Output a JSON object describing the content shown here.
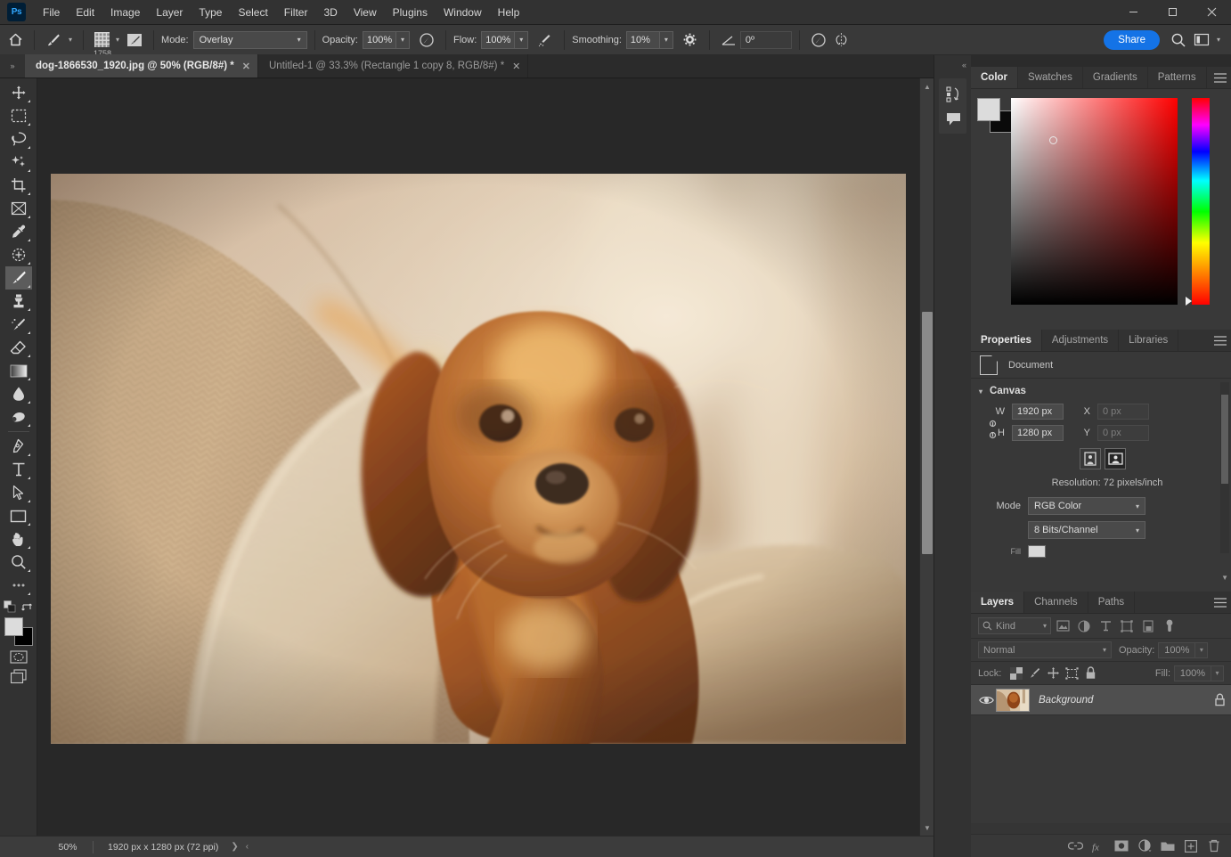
{
  "app": {
    "name": "Ps",
    "logo_color": "#31a8ff"
  },
  "menubar": {
    "items": [
      "File",
      "Edit",
      "Image",
      "Layer",
      "Type",
      "Select",
      "Filter",
      "3D",
      "View",
      "Plugins",
      "Window",
      "Help"
    ],
    "window_controls": {
      "minimize": "—",
      "maximize": "❐",
      "close": "✕"
    }
  },
  "options_bar": {
    "home_icon": "home-icon",
    "tool_icon": "brush-tool-icon",
    "brush_size": "1758",
    "brush_settings_icon": "brush-settings-icon",
    "mode_label": "Mode:",
    "mode_value": "Overlay",
    "opacity_label": "Opacity:",
    "opacity_value": "100%",
    "airbrush_icon": "airbrush-icon",
    "flow_label": "Flow:",
    "flow_value": "100%",
    "smoothing_toggle_icon": "smoothing-toggle-icon",
    "smoothing_label": "Smoothing:",
    "smoothing_value": "10%",
    "gear_icon": "gear-icon",
    "angle_icon": "angle-icon",
    "angle_value": "0º",
    "pressure_size_icon": "pressure-size-icon",
    "symmetry_icon": "symmetry-icon",
    "share_label": "Share",
    "search_icon": "search-icon",
    "workspace_icon": "workspace-icon",
    "workspace_chevron": "chevron-down-icon"
  },
  "tabbar": {
    "collapse_icon": "»",
    "tabs": [
      {
        "title": "dog-1866530_1920.jpg @ 50% (RGB/8#) *",
        "active": true,
        "close": "✕"
      },
      {
        "title": "Untitled-1 @ 33.3% (Rectangle 1 copy 8, RGB/8#) *",
        "active": false,
        "close": "✕"
      }
    ]
  },
  "toolbar": {
    "tools": [
      {
        "name": "move-tool",
        "active": false
      },
      {
        "name": "rectangular-marquee-tool",
        "active": false
      },
      {
        "name": "lasso-tool",
        "active": false
      },
      {
        "name": "object-selection-tool",
        "active": false
      },
      {
        "name": "crop-tool",
        "active": false
      },
      {
        "name": "frame-tool",
        "active": false
      },
      {
        "name": "eyedropper-tool",
        "active": false
      },
      {
        "name": "spot-healing-brush-tool",
        "active": false
      },
      {
        "name": "brush-tool",
        "active": true
      },
      {
        "name": "clone-stamp-tool",
        "active": false
      },
      {
        "name": "history-brush-tool",
        "active": false
      },
      {
        "name": "eraser-tool",
        "active": false
      },
      {
        "name": "gradient-tool",
        "active": false
      },
      {
        "name": "blur-tool",
        "active": false
      },
      {
        "name": "dodge-tool",
        "active": false
      },
      {
        "name": "pen-tool",
        "active": false
      },
      {
        "name": "horizontal-type-tool",
        "active": false
      },
      {
        "name": "path-selection-tool",
        "active": false
      },
      {
        "name": "rectangle-tool",
        "active": false
      },
      {
        "name": "hand-tool",
        "active": false
      },
      {
        "name": "zoom-tool",
        "active": false
      },
      {
        "name": "edit-toolbar-tool",
        "active": false
      }
    ],
    "foreground_color": "#dcdcdc",
    "background_color": "#000000",
    "swap_colors_icon": "swap-colors-icon",
    "default_colors_icon": "default-colors-icon",
    "quick_mask_icon": "quick-mask-icon",
    "screen_mode_icon": "screen-mode-icon"
  },
  "canvas": {
    "document_title": "dog-1866530_1920.jpg",
    "subject": "Cavalier King Charles Spaniel puppy on a beige herringbone armchair",
    "zoom_percent": "50%",
    "background_color": "#282828"
  },
  "statusbar": {
    "zoom": "50%",
    "doc_info": "1920 px x 1280 px (72 ppi)",
    "expand_icon": "❯",
    "collapse_icon": "‹"
  },
  "mini_dock": {
    "collapse_icon": "«",
    "buttons": [
      {
        "name": "history-panel-icon"
      },
      {
        "name": "comments-panel-icon"
      }
    ]
  },
  "color_panel": {
    "tabs": [
      "Color",
      "Swatches",
      "Gradients",
      "Patterns"
    ],
    "active_tab": "Color",
    "menu_icon": "panel-menu-icon",
    "foreground_color": "#dcdcdc",
    "background_color": "#0a0a0a",
    "field_type": "hue-saturation-brightness-square",
    "hue_value": "0"
  },
  "properties_panel": {
    "tabs": [
      "Properties",
      "Adjustments",
      "Libraries"
    ],
    "active_tab": "Properties",
    "menu_icon": "panel-menu-icon",
    "header_icon": "document-icon",
    "header_label": "Document",
    "section_title": "Canvas",
    "width_label": "W",
    "width_value": "1920 px",
    "height_label": "H",
    "height_value": "1280 px",
    "x_label": "X",
    "x_value": "0 px",
    "y_label": "Y",
    "y_value": "0 px",
    "link_icon": "link-dimensions-icon",
    "orientation_portrait_icon": "portrait-orientation-icon",
    "orientation_landscape_icon": "landscape-orientation-icon",
    "orientation_selected": "landscape",
    "resolution_text": "Resolution: 72 pixels/inch",
    "mode_label": "Mode",
    "color_mode_value": "RGB Color",
    "bit_depth_value": "8 Bits/Channel",
    "fill_label": "Fill"
  },
  "layers_panel": {
    "tabs": [
      "Layers",
      "Channels",
      "Paths"
    ],
    "active_tab": "Layers",
    "menu_icon": "panel-menu-icon",
    "filter_label": "Kind",
    "filter_search_icon": "search-icon",
    "filter_icons": [
      "pixel-layer-filter-icon",
      "adjustment-layer-filter-icon",
      "type-layer-filter-icon",
      "shape-layer-filter-icon",
      "smart-object-filter-icon",
      "filter-toggle-icon"
    ],
    "blend_mode": "Normal",
    "opacity_label": "Opacity:",
    "opacity_value": "100%",
    "lock_label": "Lock:",
    "lock_icons": [
      "lock-transparent-pixels-icon",
      "lock-image-pixels-icon",
      "lock-position-icon",
      "lock-artboard-nesting-icon",
      "lock-all-icon"
    ],
    "fill_label": "Fill:",
    "fill_value": "100%",
    "layers": [
      {
        "name": "Background",
        "visible": true,
        "locked": true,
        "selected": true,
        "eye_icon": "visibility-eye-icon",
        "lock_icon": "lock-icon"
      }
    ],
    "footer_icons": [
      "link-layers-icon",
      "layer-style-fx-icon",
      "add-layer-mask-icon",
      "new-adjustment-layer-icon",
      "new-group-icon",
      "new-layer-icon",
      "delete-layer-icon"
    ]
  }
}
